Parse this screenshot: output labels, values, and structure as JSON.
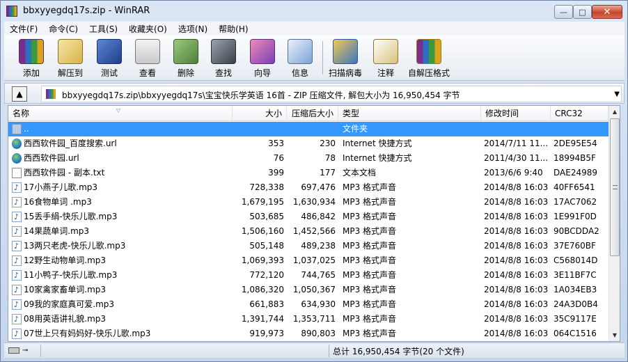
{
  "window": {
    "title": "bbxyyegdq17s.zip - WinRAR",
    "controls": {
      "minimize": "—",
      "maximize": "□",
      "close": "✕"
    }
  },
  "menu": [
    "文件(F)",
    "命令(C)",
    "工具(S)",
    "收藏夹(O)",
    "选项(N)",
    "帮助(H)"
  ],
  "toolbar": [
    {
      "label": "添加",
      "icon": "add-archive-icon"
    },
    {
      "label": "解压到",
      "icon": "extract-to-icon"
    },
    {
      "label": "测试",
      "icon": "test-icon"
    },
    {
      "label": "查看",
      "icon": "view-icon"
    },
    {
      "label": "删除",
      "icon": "delete-icon"
    },
    {
      "label": "查找",
      "icon": "find-icon"
    },
    {
      "label": "向导",
      "icon": "wizard-icon"
    },
    {
      "label": "信息",
      "icon": "info-icon"
    },
    {
      "label": "扫描病毒",
      "icon": "virus-scan-icon"
    },
    {
      "label": "注释",
      "icon": "comment-icon"
    },
    {
      "label": "自解压格式",
      "icon": "sfx-icon"
    }
  ],
  "address": {
    "up_icon": "▲",
    "path": "bbxyyegdq17s.zip\\bbxyyegdq17s\\宝宝快乐学英语 16首 - ZIP 压缩文件, 解包大小为 16,950,454 字节",
    "dropdown": "▼"
  },
  "columns": {
    "name": "名称",
    "size": "大小",
    "packed": "压缩后大小",
    "type": "类型",
    "modified": "修改时间",
    "crc": "CRC32",
    "sort_indicator": "▽"
  },
  "files": [
    {
      "icon": "folder-up",
      "name": "..",
      "size": "",
      "packed": "",
      "type": "文件夹",
      "modified": "",
      "crc": ""
    },
    {
      "icon": "url",
      "name": "西西软件园_百度搜索.url",
      "size": "353",
      "packed": "230",
      "type": "Internet 快捷方式",
      "modified": "2014/7/11 11...",
      "crc": "2DE95E54"
    },
    {
      "icon": "url",
      "name": "西西软件园.url",
      "size": "76",
      "packed": "78",
      "type": "Internet 快捷方式",
      "modified": "2011/4/30 11...",
      "crc": "18994B5F"
    },
    {
      "icon": "txt",
      "name": "西西软件园 - 副本.txt",
      "size": "399",
      "packed": "177",
      "type": "文本文档",
      "modified": "2013/6/6 9:40",
      "crc": "DAE24989"
    },
    {
      "icon": "mp3",
      "name": "17小燕子儿歌.mp3",
      "size": "728,338",
      "packed": "697,476",
      "type": "MP3 格式声音",
      "modified": "2014/8/8 16:03",
      "crc": "40FF6541"
    },
    {
      "icon": "mp3",
      "name": "16食物单词 .mp3",
      "size": "1,679,195",
      "packed": "1,630,934",
      "type": "MP3 格式声音",
      "modified": "2014/8/8 16:03",
      "crc": "17AC7062"
    },
    {
      "icon": "mp3",
      "name": "15丢手绢-快乐儿歌.mp3",
      "size": "503,685",
      "packed": "486,842",
      "type": "MP3 格式声音",
      "modified": "2014/8/8 16:03",
      "crc": "1E991F0D"
    },
    {
      "icon": "mp3",
      "name": "14果蔬单词.mp3",
      "size": "1,506,160",
      "packed": "1,452,566",
      "type": "MP3 格式声音",
      "modified": "2014/8/8 16:03",
      "crc": "90BCDDA2"
    },
    {
      "icon": "mp3",
      "name": "13两只老虎-快乐儿歌.mp3",
      "size": "505,148",
      "packed": "489,238",
      "type": "MP3 格式声音",
      "modified": "2014/8/8 16:03",
      "crc": "37E760BF"
    },
    {
      "icon": "mp3",
      "name": "12野生动物单词.mp3",
      "size": "1,069,393",
      "packed": "1,037,025",
      "type": "MP3 格式声音",
      "modified": "2014/8/8 16:03",
      "crc": "C568014D"
    },
    {
      "icon": "mp3",
      "name": "11小鸭子-快乐儿歌.mp3",
      "size": "772,120",
      "packed": "744,765",
      "type": "MP3 格式声音",
      "modified": "2014/8/8 16:03",
      "crc": "3E11BF7C"
    },
    {
      "icon": "mp3",
      "name": "10家禽家畜单词.mp3",
      "size": "1,086,320",
      "packed": "1,050,367",
      "type": "MP3 格式声音",
      "modified": "2014/8/8 16:03",
      "crc": "1A034EB3"
    },
    {
      "icon": "mp3",
      "name": "09我的家庭真可爱.mp3",
      "size": "661,883",
      "packed": "634,930",
      "type": "MP3 格式声音",
      "modified": "2014/8/8 16:03",
      "crc": "24A3D0B4"
    },
    {
      "icon": "mp3",
      "name": "08用英语讲礼貌.mp3",
      "size": "1,391,744",
      "packed": "1,353,711",
      "type": "MP3 格式声音",
      "modified": "2014/8/8 16:03",
      "crc": "35C9117E"
    },
    {
      "icon": "mp3",
      "name": "07世上只有妈妈好-快乐儿歌.mp3",
      "size": "919,973",
      "packed": "890,803",
      "type": "MP3 格式声音",
      "modified": "2014/8/8 16:03",
      "crc": "064C1516"
    }
  ],
  "selected_row": 0,
  "status": {
    "summary": "总计 16,950,454 字节(20 个文件)"
  },
  "scrollbar": {
    "up": "▲",
    "down": "▼"
  },
  "colors": {
    "selection": "#3399ff",
    "title_close": "#c7452c"
  }
}
